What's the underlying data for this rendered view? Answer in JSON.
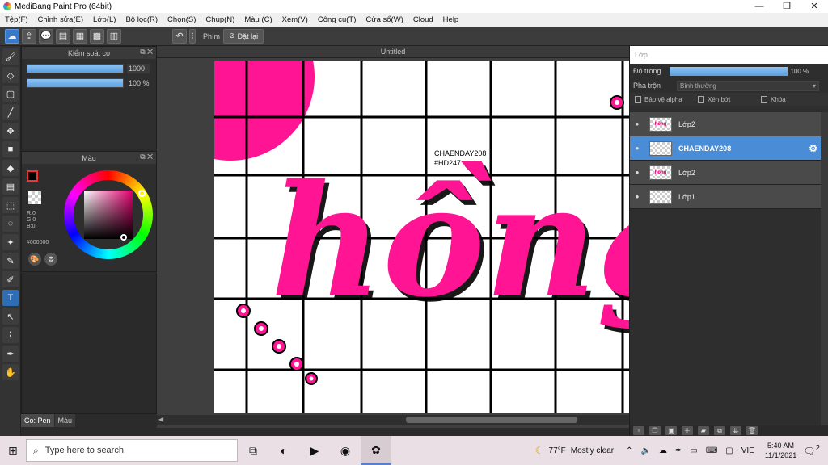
{
  "window": {
    "title": "MediBang Paint Pro (64bit)",
    "controls": {
      "minimize": "—",
      "maximize": "❐",
      "close": "✕"
    }
  },
  "menu": [
    "Tệp(F)",
    "Chỉnh sửa(E)",
    "Lớp(L)",
    "Bộ lọc(R)",
    "Chọn(S)",
    "Chụp(N)",
    "Màu (C)",
    "Xem(V)",
    "Công cụ(T)",
    "Cửa sổ(W)",
    "Cloud",
    "Help"
  ],
  "toolbar": {
    "shortcut_label": "Phím",
    "reset_label": "Đặt lại"
  },
  "brush_panel": {
    "title": "Kiểm soát cọ",
    "size_value": "1000",
    "opacity_value": "100 %"
  },
  "color_panel": {
    "title": "Màu",
    "r": "R:0",
    "g": "G:0",
    "b": "B:0",
    "hex": "#000000",
    "hue_color": "#e2006f"
  },
  "left_tabs": {
    "pen": "Co: Pen",
    "color": "Màu"
  },
  "canvas": {
    "doc_title": "Untitled",
    "text_line1": "CHAENDAY208",
    "text_line2": "#HD247",
    "lettering": "hồng",
    "accent": "#ff1493"
  },
  "layers_panel": {
    "title": "Lớp",
    "opacity_label": "Độ trong",
    "opacity_value": "100 %",
    "opacity_fraction": 1.0,
    "blend_label": "Pha trộn",
    "blend_value": "Bình thường",
    "protect_alpha": "Bảo vệ alpha",
    "clipping": "Xén bớt",
    "lock": "Khóa",
    "layers": [
      {
        "name": "Lớp2",
        "selected": false,
        "thumb": "hồng"
      },
      {
        "name": "CHAENDAY208",
        "selected": true,
        "thumb": ""
      },
      {
        "name": "Lớp2",
        "selected": false,
        "thumb": "hồng"
      },
      {
        "name": "Lớp1",
        "selected": false,
        "thumb": ""
      }
    ]
  },
  "taskbar": {
    "search_placeholder": "Type here to search",
    "weather_temp": "77°F",
    "weather_desc": "Mostly clear",
    "lang": "VIE",
    "time": "5:40 AM",
    "date": "11/1/2021",
    "notifications": "2"
  }
}
